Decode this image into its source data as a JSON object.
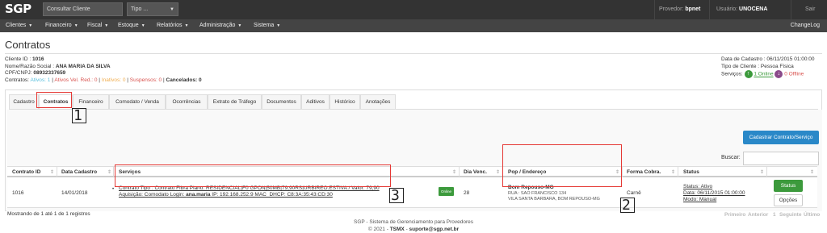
{
  "topbar": {
    "logo": "SGP",
    "search_placeholder": "Consultar Cliente",
    "tipo_value": "Tipo ...",
    "provedor_label": "Provedor:",
    "provedor_value": "bpnet",
    "usuario_label": "Usuário:",
    "usuario_value": "UNOCENA",
    "sair_label": "Sair"
  },
  "nav": {
    "items": [
      "Clientes",
      "Financeiro",
      "Fiscal",
      "Estoque",
      "Relatórios",
      "Administração",
      "Sistema"
    ],
    "changelog": "ChangeLog"
  },
  "page": {
    "title": "Contratos"
  },
  "client": {
    "id_label": "Cliente ID :",
    "id_value": "1016",
    "nome_label": "Nome/Razão Social :",
    "nome_value": "ANA MARIA DA SILVA",
    "cpf_label": "CPF/CNPJ:",
    "cpf_value": "08932337659",
    "contratos_label": "Contratos:",
    "ativos": "Ativos: 1",
    "ativos_vel": "Ativos Vel. Red.: 0",
    "inativos": "Inativos: 0",
    "suspensos": "Suspensos: 0",
    "cancelados": "Cancelados: 0",
    "sep": "|",
    "data_cadastro": "Data de Cadastro : 06/11/2015 01:00:00",
    "tipo_cliente": "Tipo de Cliente : Pessoa Física",
    "servicos_label": "Serviços:",
    "online": "1 Online",
    "offline": "0 Offline"
  },
  "tabs": [
    "Cadastro",
    "Contratos",
    "Financeiro",
    "Comodato / Venda",
    "Ocorrências",
    "Extrato de Tráfego",
    "Documentos",
    "Aditivos",
    "Histórico",
    "Anotações"
  ],
  "actions": {
    "cadastrar": "Cadastrar Contrato/Serviço",
    "buscar": "Buscar:"
  },
  "table": {
    "headers": [
      "Contrato ID",
      "Data Cadastro",
      "Serviços",
      "Dia Venc.",
      "Pop / Endereço",
      "Forma Cobra.",
      "Status"
    ],
    "row": {
      "contrato_id": "1016",
      "data_cadastro": "14/01/2018",
      "servico_line1": "Contrato Tipo : Contrato Fibra Plano: RESIDENCIAL|F0 GPON|50MB|79,90RS|URBIREO.ESTIVA / Valor: 79,90",
      "servico_line2_prefix": "Aquisição: Comodato   Login: ",
      "servico_login": "ana.maria",
      "servico_line2_suffix": " IP: 192.168.252.9 MAC_DHCP: C8:3A:35:43:CD:30",
      "online_badge": "Online",
      "dia_venc": "28",
      "pop_name": "Bom Repouso-MG",
      "pop_rua": "RUA : SAO FRANCISCO 134",
      "pop_bairro": "VILA SANTA BARBARA, BOM REPOUSO-MG",
      "forma_cobranca": "Carnê",
      "status": "Status: Ativo",
      "data": "Data: 06/11/2015 01:00:00",
      "modo": "Modo: Manual",
      "btn_status": "Status",
      "btn_opcoes": "Opções"
    },
    "info": "Mostrando de 1 até 1 de 1 registros",
    "pager": [
      "Primeiro",
      "Anterior",
      "1",
      "Seguinte",
      "Último"
    ]
  },
  "callouts": [
    "1",
    "2",
    "3"
  ],
  "footer": {
    "line1": "SGP - Sistema de Gerenciamento para Provedores",
    "line2_prefix": "© 2021 - ",
    "brand": "TSMX",
    "line2_sep": " - ",
    "email": "suporte@sgp.net.br"
  },
  "colors": {
    "topbar": "#333333",
    "navbar": "#444444",
    "primary": "#2a88c8",
    "success": "#3c9a3c",
    "annotation": "#e53935"
  }
}
